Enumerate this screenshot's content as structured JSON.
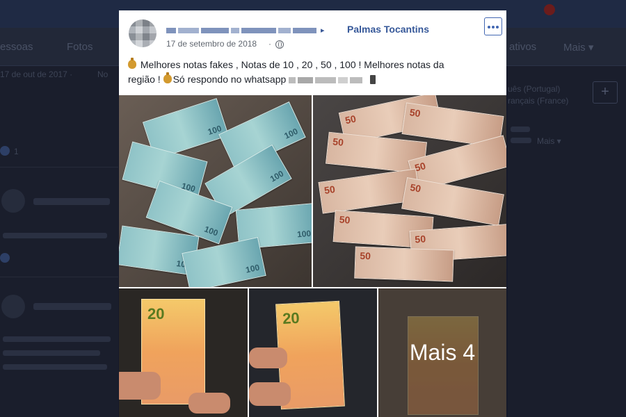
{
  "background": {
    "tabs": [
      "essoas",
      "Fotos",
      "ativos",
      "Mais ▾"
    ],
    "left_date": "17 de out de 2017 · ",
    "left_extra": "No",
    "left_count": "1",
    "right_lines": [
      "uês (Portugal)",
      "rançais (France)"
    ],
    "right_more": "Mais ▾",
    "plus_label": "+"
  },
  "post": {
    "page_name": "Palmas Tocantins",
    "date": "17 de setembro de 2018",
    "separator": "·",
    "text_line1": " Melhores notas fakes , Notas de 10 , 20 , 50 , 100 ! Melhores notas da",
    "text_line2_a": "região ! ",
    "text_line2_b": "Só respondo no whatsapp",
    "more_photos_label": "Mais 4"
  },
  "colors": {
    "link": "#365899",
    "card_bg": "#ffffff",
    "overlay_bg": "#15192a"
  },
  "icons": [
    "money-bag-icon",
    "globe-icon",
    "more-options-icon",
    "phone-icon"
  ]
}
